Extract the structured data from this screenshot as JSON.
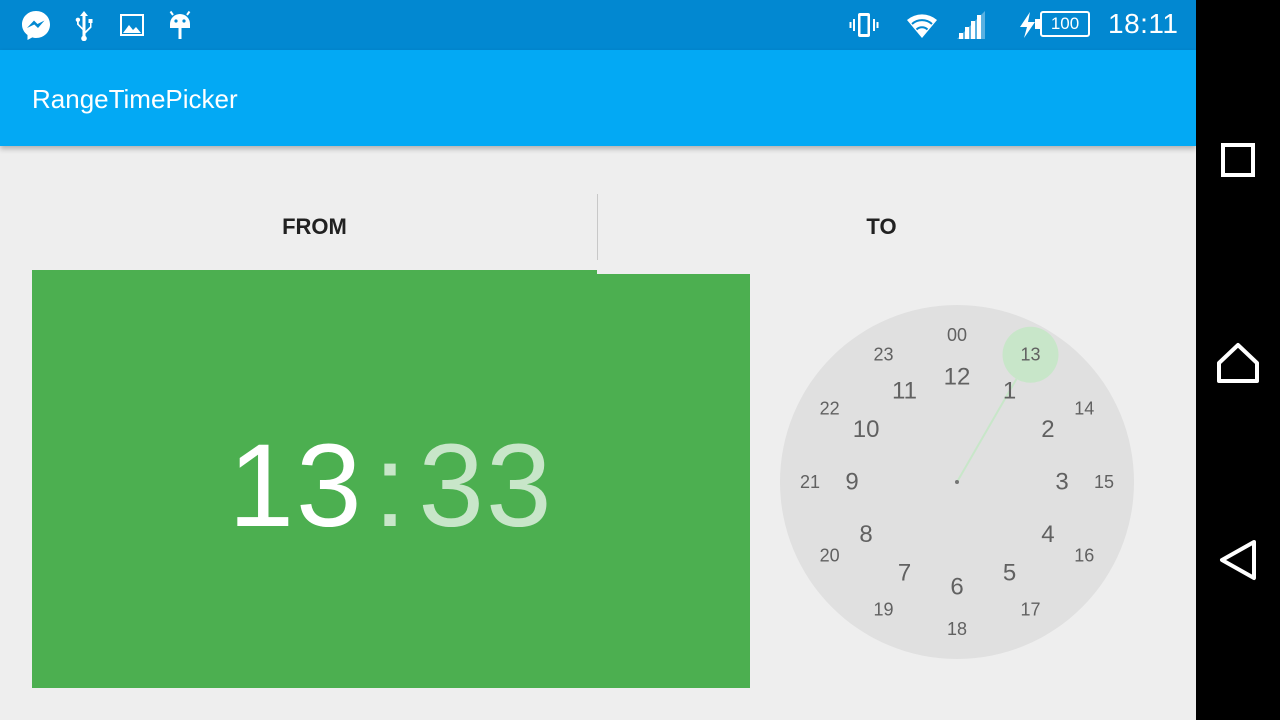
{
  "status_bar": {
    "time": "18:11",
    "battery": "100",
    "icons": [
      "messenger-icon",
      "usb-icon",
      "image-icon",
      "android-icon",
      "vibrate-icon",
      "wifi-icon",
      "signal-icon",
      "charging-icon"
    ]
  },
  "app_bar": {
    "title": "RangeTimePicker"
  },
  "tabs": {
    "from": "FROM",
    "to": "TO",
    "selected": "FROM"
  },
  "time_display": {
    "hours": "13",
    "separator": ":",
    "minutes": "33"
  },
  "clock": {
    "selected_hour": "13",
    "hand_angle_deg": 30,
    "outer_labels": [
      "12",
      "1",
      "2",
      "3",
      "4",
      "5",
      "6",
      "7",
      "8",
      "9",
      "10",
      "11"
    ],
    "inner_labels": [
      "00",
      "13",
      "14",
      "15",
      "16",
      "17",
      "18",
      "19",
      "20",
      "21",
      "22",
      "23"
    ]
  },
  "colors": {
    "status_bar": "#0288D1",
    "app_bar": "#03A9F4",
    "accent": "#4CAF50",
    "accent_light": "#C8E6C9",
    "clock_face": "#E0E0E0",
    "background": "#EEEEEE"
  },
  "nav_bar": {
    "icons": [
      "recents-icon",
      "home-icon",
      "back-icon"
    ]
  }
}
